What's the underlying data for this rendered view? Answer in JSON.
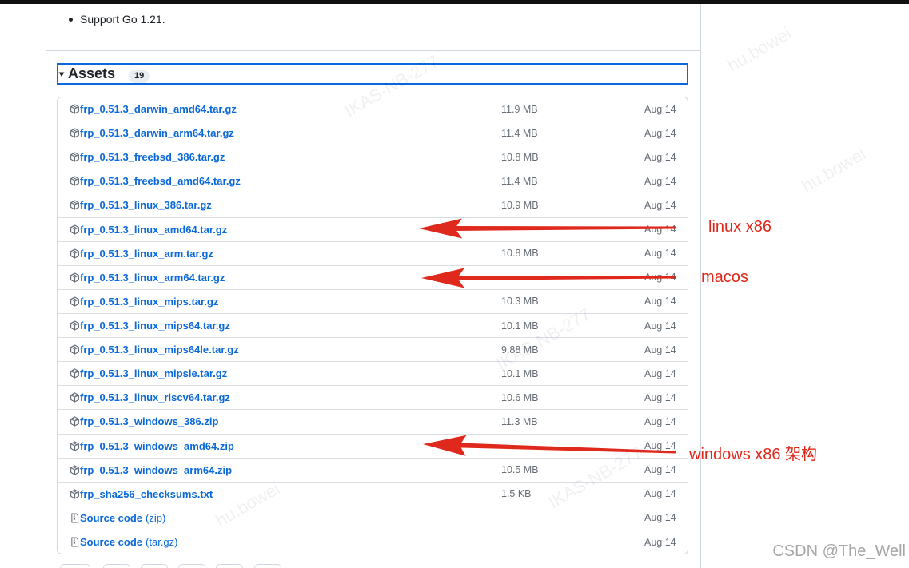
{
  "release": {
    "notes": [
      "Support Go 1.21."
    ]
  },
  "assets": {
    "toggle_icon": "triangle-down-icon",
    "title": "Assets",
    "count": "19",
    "items": [
      {
        "icon": "package-icon",
        "name": "frp_0.51.3_darwin_amd64.tar.gz",
        "size": "11.9 MB",
        "date": "Aug 14"
      },
      {
        "icon": "package-icon",
        "name": "frp_0.51.3_darwin_arm64.tar.gz",
        "size": "11.4 MB",
        "date": "Aug 14"
      },
      {
        "icon": "package-icon",
        "name": "frp_0.51.3_freebsd_386.tar.gz",
        "size": "10.8 MB",
        "date": "Aug 14"
      },
      {
        "icon": "package-icon",
        "name": "frp_0.51.3_freebsd_amd64.tar.gz",
        "size": "11.4 MB",
        "date": "Aug 14"
      },
      {
        "icon": "package-icon",
        "name": "frp_0.51.3_linux_386.tar.gz",
        "size": "10.9 MB",
        "date": "Aug 14"
      },
      {
        "icon": "package-icon",
        "name": "frp_0.51.3_linux_amd64.tar.gz",
        "size": "",
        "date": "Aug 14"
      },
      {
        "icon": "package-icon",
        "name": "frp_0.51.3_linux_arm.tar.gz",
        "size": "10.8 MB",
        "date": "Aug 14"
      },
      {
        "icon": "package-icon",
        "name": "frp_0.51.3_linux_arm64.tar.gz",
        "size": "",
        "date": "Aug 14"
      },
      {
        "icon": "package-icon",
        "name": "frp_0.51.3_linux_mips.tar.gz",
        "size": "10.3 MB",
        "date": "Aug 14"
      },
      {
        "icon": "package-icon",
        "name": "frp_0.51.3_linux_mips64.tar.gz",
        "size": "10.1 MB",
        "date": "Aug 14"
      },
      {
        "icon": "package-icon",
        "name": "frp_0.51.3_linux_mips64le.tar.gz",
        "size": "9.88 MB",
        "date": "Aug 14"
      },
      {
        "icon": "package-icon",
        "name": "frp_0.51.3_linux_mipsle.tar.gz",
        "size": "10.1 MB",
        "date": "Aug 14"
      },
      {
        "icon": "package-icon",
        "name": "frp_0.51.3_linux_riscv64.tar.gz",
        "size": "10.6 MB",
        "date": "Aug 14"
      },
      {
        "icon": "package-icon",
        "name": "frp_0.51.3_windows_386.zip",
        "size": "11.3 MB",
        "date": "Aug 14"
      },
      {
        "icon": "package-icon",
        "name": "frp_0.51.3_windows_amd64.zip",
        "size": "",
        "date": "Aug 14"
      },
      {
        "icon": "package-icon",
        "name": "frp_0.51.3_windows_arm64.zip",
        "size": "10.5 MB",
        "date": "Aug 14"
      },
      {
        "icon": "package-icon",
        "name": "frp_sha256_checksums.txt",
        "size": "1.5 KB",
        "date": "Aug 14"
      },
      {
        "icon": "file-zip-icon",
        "name": "Source code",
        "suffix": "(zip)",
        "date": "Aug 14"
      },
      {
        "icon": "file-zip-icon",
        "name": "Source code",
        "suffix": "(tar.gz)",
        "date": "Aug 14"
      }
    ]
  },
  "annotations": [
    {
      "label": "linux x86",
      "icon": "arrow-left-icon"
    },
    {
      "label": "macos",
      "icon": "arrow-left-icon"
    },
    {
      "label": "windows x86 架构",
      "icon": "arrow-left-icon"
    }
  ],
  "watermark": {
    "user": "hu.bowei",
    "host": "IKAS-NB-277"
  },
  "credit": "CSDN @The_Well",
  "colors": {
    "link": "#0969da",
    "text": "#1f2328",
    "muted": "#656d76",
    "border": "#d0d7de",
    "focus": "#0969da",
    "annotation": "#e0291d",
    "credit": "#a6a6a6",
    "top_bar": "#111111"
  }
}
